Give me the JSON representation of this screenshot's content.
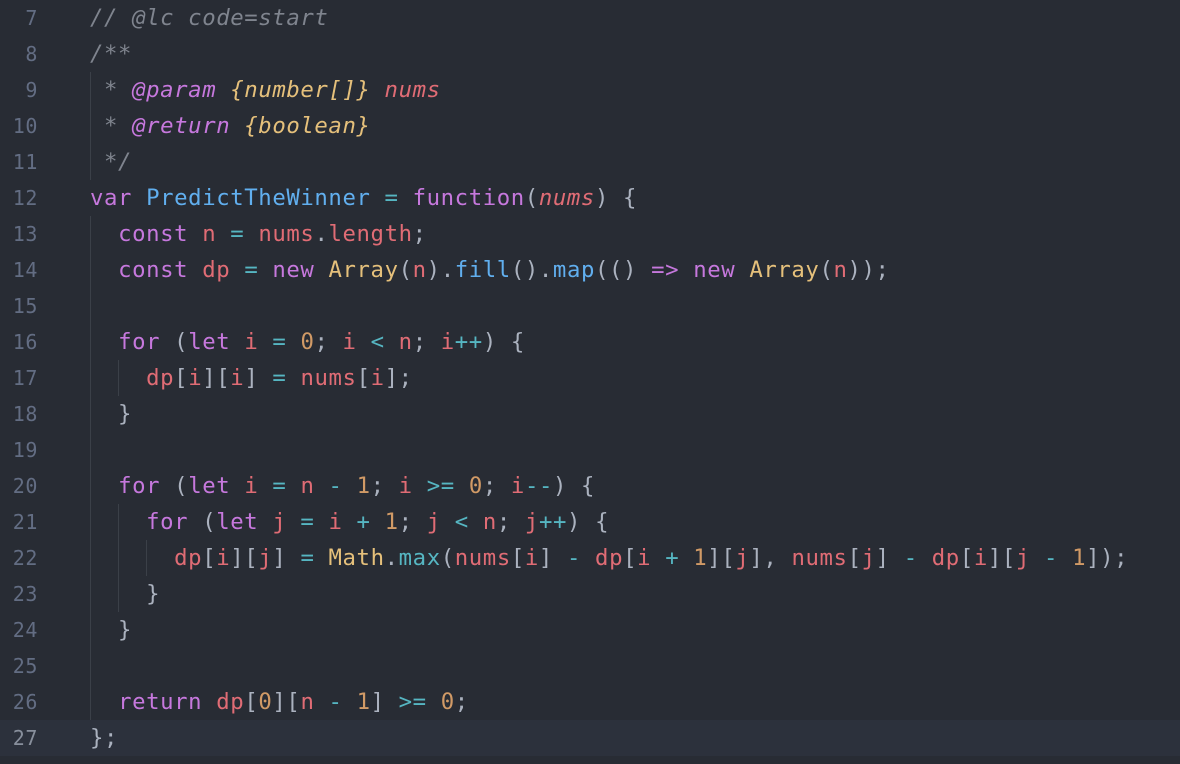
{
  "editor": {
    "theme_colors": {
      "background": "#282c34",
      "current_line": "#2c313c",
      "comment": "#7f848e",
      "keyword": "#c678dd",
      "function": "#61afef",
      "variable": "#e06c75",
      "operator": "#56b6c2",
      "number": "#d19a66",
      "type": "#e5c07b",
      "punctuation": "#abb2bf",
      "line_number": "#636d83"
    },
    "lines": [
      {
        "n": "7",
        "tokens": [
          [
            "// @lc code=start",
            "c"
          ]
        ]
      },
      {
        "n": "8",
        "tokens": [
          [
            "/**",
            "c"
          ]
        ]
      },
      {
        "n": "9",
        "tokens": [
          [
            " * ",
            "c"
          ],
          [
            "@param",
            "ct"
          ],
          [
            " ",
            "c"
          ],
          [
            "{number[]}",
            "cy"
          ],
          [
            " ",
            "c"
          ],
          [
            "nums",
            "cr"
          ]
        ]
      },
      {
        "n": "10",
        "tokens": [
          [
            " * ",
            "c"
          ],
          [
            "@return",
            "ct"
          ],
          [
            " ",
            "c"
          ],
          [
            "{boolean}",
            "cy"
          ]
        ]
      },
      {
        "n": "11",
        "tokens": [
          [
            " */",
            "c"
          ]
        ]
      },
      {
        "n": "12",
        "tokens": [
          [
            "var",
            "k"
          ],
          [
            " ",
            "p"
          ],
          [
            "PredictTheWinner",
            "f"
          ],
          [
            " ",
            "p"
          ],
          [
            "=",
            "o"
          ],
          [
            " ",
            "p"
          ],
          [
            "function",
            "k"
          ],
          [
            "(",
            "p"
          ],
          [
            "nums",
            "vi"
          ],
          [
            ") {",
            "p"
          ]
        ]
      },
      {
        "n": "13",
        "tokens": [
          [
            "  ",
            "p"
          ],
          [
            "const",
            "k"
          ],
          [
            " ",
            "p"
          ],
          [
            "n",
            "v"
          ],
          [
            " ",
            "p"
          ],
          [
            "=",
            "o"
          ],
          [
            " ",
            "p"
          ],
          [
            "nums",
            "v"
          ],
          [
            ".",
            "p"
          ],
          [
            "length",
            "v"
          ],
          [
            ";",
            "p"
          ]
        ]
      },
      {
        "n": "14",
        "tokens": [
          [
            "  ",
            "p"
          ],
          [
            "const",
            "k"
          ],
          [
            " ",
            "p"
          ],
          [
            "dp",
            "v"
          ],
          [
            " ",
            "p"
          ],
          [
            "=",
            "o"
          ],
          [
            " ",
            "p"
          ],
          [
            "new",
            "k"
          ],
          [
            " ",
            "p"
          ],
          [
            "Array",
            "y"
          ],
          [
            "(",
            "p"
          ],
          [
            "n",
            "v"
          ],
          [
            ").",
            "p"
          ],
          [
            "fill",
            "f"
          ],
          [
            "().",
            "p"
          ],
          [
            "map",
            "f"
          ],
          [
            "(() ",
            "p"
          ],
          [
            "=>",
            "k"
          ],
          [
            " ",
            "p"
          ],
          [
            "new",
            "k"
          ],
          [
            " ",
            "p"
          ],
          [
            "Array",
            "y"
          ],
          [
            "(",
            "p"
          ],
          [
            "n",
            "v"
          ],
          [
            "));",
            "p"
          ]
        ]
      },
      {
        "n": "15",
        "tokens": []
      },
      {
        "n": "16",
        "tokens": [
          [
            "  ",
            "p"
          ],
          [
            "for",
            "k"
          ],
          [
            " (",
            "p"
          ],
          [
            "let",
            "k"
          ],
          [
            " ",
            "p"
          ],
          [
            "i",
            "v"
          ],
          [
            " ",
            "p"
          ],
          [
            "=",
            "o"
          ],
          [
            " ",
            "p"
          ],
          [
            "0",
            "n"
          ],
          [
            "; ",
            "p"
          ],
          [
            "i",
            "v"
          ],
          [
            " ",
            "p"
          ],
          [
            "<",
            "o"
          ],
          [
            " ",
            "p"
          ],
          [
            "n",
            "v"
          ],
          [
            "; ",
            "p"
          ],
          [
            "i",
            "v"
          ],
          [
            "++",
            "o"
          ],
          [
            ") {",
            "p"
          ]
        ]
      },
      {
        "n": "17",
        "tokens": [
          [
            "    ",
            "p"
          ],
          [
            "dp",
            "v"
          ],
          [
            "[",
            "p"
          ],
          [
            "i",
            "v"
          ],
          [
            "][",
            "p"
          ],
          [
            "i",
            "v"
          ],
          [
            "] ",
            "p"
          ],
          [
            "=",
            "o"
          ],
          [
            " ",
            "p"
          ],
          [
            "nums",
            "v"
          ],
          [
            "[",
            "p"
          ],
          [
            "i",
            "v"
          ],
          [
            "];",
            "p"
          ]
        ]
      },
      {
        "n": "18",
        "tokens": [
          [
            "  }",
            "p"
          ]
        ]
      },
      {
        "n": "19",
        "tokens": []
      },
      {
        "n": "20",
        "tokens": [
          [
            "  ",
            "p"
          ],
          [
            "for",
            "k"
          ],
          [
            " (",
            "p"
          ],
          [
            "let",
            "k"
          ],
          [
            " ",
            "p"
          ],
          [
            "i",
            "v"
          ],
          [
            " ",
            "p"
          ],
          [
            "=",
            "o"
          ],
          [
            " ",
            "p"
          ],
          [
            "n",
            "v"
          ],
          [
            " ",
            "p"
          ],
          [
            "-",
            "o"
          ],
          [
            " ",
            "p"
          ],
          [
            "1",
            "n"
          ],
          [
            "; ",
            "p"
          ],
          [
            "i",
            "v"
          ],
          [
            " ",
            "p"
          ],
          [
            ">=",
            "o"
          ],
          [
            " ",
            "p"
          ],
          [
            "0",
            "n"
          ],
          [
            "; ",
            "p"
          ],
          [
            "i",
            "v"
          ],
          [
            "--",
            "o"
          ],
          [
            ") {",
            "p"
          ]
        ]
      },
      {
        "n": "21",
        "tokens": [
          [
            "    ",
            "p"
          ],
          [
            "for",
            "k"
          ],
          [
            " (",
            "p"
          ],
          [
            "let",
            "k"
          ],
          [
            " ",
            "p"
          ],
          [
            "j",
            "v"
          ],
          [
            " ",
            "p"
          ],
          [
            "=",
            "o"
          ],
          [
            " ",
            "p"
          ],
          [
            "i",
            "v"
          ],
          [
            " ",
            "p"
          ],
          [
            "+",
            "o"
          ],
          [
            " ",
            "p"
          ],
          [
            "1",
            "n"
          ],
          [
            "; ",
            "p"
          ],
          [
            "j",
            "v"
          ],
          [
            " ",
            "p"
          ],
          [
            "<",
            "o"
          ],
          [
            " ",
            "p"
          ],
          [
            "n",
            "v"
          ],
          [
            "; ",
            "p"
          ],
          [
            "j",
            "v"
          ],
          [
            "++",
            "o"
          ],
          [
            ") {",
            "p"
          ]
        ]
      },
      {
        "n": "22",
        "tokens": [
          [
            "      ",
            "p"
          ],
          [
            "dp",
            "v"
          ],
          [
            "[",
            "p"
          ],
          [
            "i",
            "v"
          ],
          [
            "][",
            "p"
          ],
          [
            "j",
            "v"
          ],
          [
            "] ",
            "p"
          ],
          [
            "=",
            "o"
          ],
          [
            " ",
            "p"
          ],
          [
            "Math",
            "y"
          ],
          [
            ".",
            "p"
          ],
          [
            "max",
            "o"
          ],
          [
            "(",
            "p"
          ],
          [
            "nums",
            "v"
          ],
          [
            "[",
            "p"
          ],
          [
            "i",
            "v"
          ],
          [
            "] ",
            "p"
          ],
          [
            "-",
            "o"
          ],
          [
            " ",
            "p"
          ],
          [
            "dp",
            "v"
          ],
          [
            "[",
            "p"
          ],
          [
            "i",
            "v"
          ],
          [
            " ",
            "p"
          ],
          [
            "+",
            "o"
          ],
          [
            " ",
            "p"
          ],
          [
            "1",
            "n"
          ],
          [
            "][",
            "p"
          ],
          [
            "j",
            "v"
          ],
          [
            "], ",
            "p"
          ],
          [
            "nums",
            "v"
          ],
          [
            "[",
            "p"
          ],
          [
            "j",
            "v"
          ],
          [
            "] ",
            "p"
          ],
          [
            "-",
            "o"
          ],
          [
            " ",
            "p"
          ],
          [
            "dp",
            "v"
          ],
          [
            "[",
            "p"
          ],
          [
            "i",
            "v"
          ],
          [
            "][",
            "p"
          ],
          [
            "j",
            "v"
          ],
          [
            " ",
            "p"
          ],
          [
            "-",
            "o"
          ],
          [
            " ",
            "p"
          ],
          [
            "1",
            "n"
          ],
          [
            "]);",
            "p"
          ]
        ]
      },
      {
        "n": "23",
        "tokens": [
          [
            "    }",
            "p"
          ]
        ]
      },
      {
        "n": "24",
        "tokens": [
          [
            "  }",
            "p"
          ]
        ]
      },
      {
        "n": "25",
        "tokens": []
      },
      {
        "n": "26",
        "tokens": [
          [
            "  ",
            "p"
          ],
          [
            "return",
            "k"
          ],
          [
            " ",
            "p"
          ],
          [
            "dp",
            "v"
          ],
          [
            "[",
            "p"
          ],
          [
            "0",
            "n"
          ],
          [
            "][",
            "p"
          ],
          [
            "n",
            "v"
          ],
          [
            " ",
            "p"
          ],
          [
            "-",
            "o"
          ],
          [
            " ",
            "p"
          ],
          [
            "1",
            "n"
          ],
          [
            "] ",
            "p"
          ],
          [
            ">=",
            "o"
          ],
          [
            " ",
            "p"
          ],
          [
            "0",
            "n"
          ],
          [
            ";",
            "p"
          ]
        ]
      },
      {
        "n": "27",
        "tokens": [
          [
            "};",
            "p"
          ]
        ],
        "current": true
      }
    ]
  }
}
